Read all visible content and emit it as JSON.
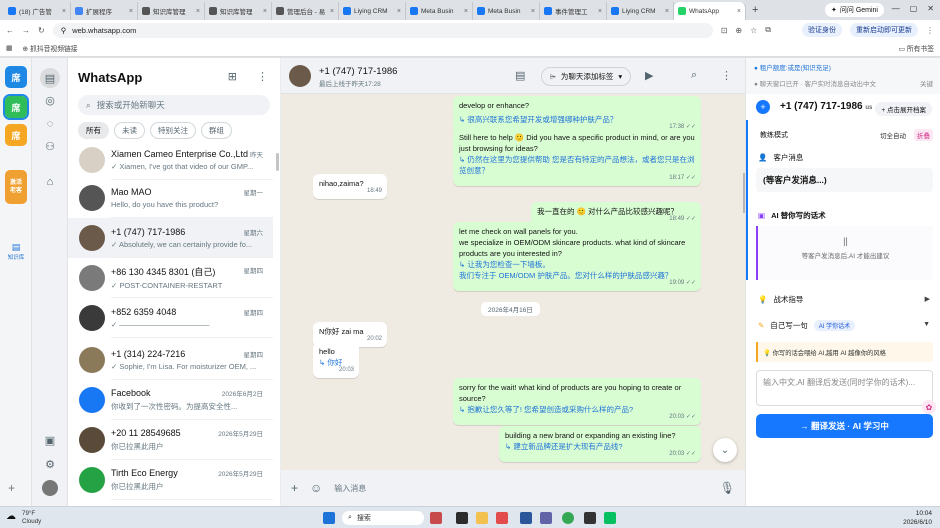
{
  "browser": {
    "tabs": [
      {
        "label": "(18) 广告管",
        "color": "#1877f2"
      },
      {
        "label": "扩展程序",
        "color": "#4285f4"
      },
      {
        "label": "知识库管理",
        "color": "#555555"
      },
      {
        "label": "知识库管理",
        "color": "#555555"
      },
      {
        "label": "管理后台 - 易",
        "color": "#555555"
      },
      {
        "label": "Liying CRM",
        "color": "#1877f2"
      },
      {
        "label": "Meta Busin",
        "color": "#1877f2"
      },
      {
        "label": "Meta Busin",
        "color": "#1877f2"
      },
      {
        "label": "事件管理工",
        "color": "#1877f2"
      },
      {
        "label": "Liying CRM",
        "color": "#1877f2"
      },
      {
        "label": "WhatsApp",
        "color": "#25d366"
      }
    ],
    "new_tab": "+",
    "gemini": "问问 Gemini",
    "url": "web.whatsapp.com",
    "verify": "验证身份",
    "restart": "重新启动即可更新",
    "bookmark": "抓抖音视频链接",
    "all_bookmarks": "所有书签"
  },
  "plugin_strip": {
    "buttons": [
      "席",
      "席",
      "席"
    ],
    "tool_btn": "激活\n老客",
    "label": "知识库"
  },
  "whatsapp": {
    "title": "WhatsApp",
    "search_placeholder": "搜索或开始新聊天",
    "filters": [
      "所有",
      "未读",
      "特别关注",
      "群组"
    ],
    "chats": [
      {
        "name": "Xiamen Cameo Enterprise Co.,Ltd",
        "time": "昨天",
        "snippet": "✓ Xiamen, I've got that video of our GMP...",
        "avatar_color": "#d8d0c4"
      },
      {
        "name": "Mao MAO",
        "time": "星期一",
        "snippet": "Hello, do you have this product?",
        "avatar_color": "#555555"
      },
      {
        "name": "+1 (747) 717-1986",
        "time": "星期六",
        "snippet": "✓ Absolutely, we can certainly provide fo...",
        "avatar_color": "#6b5a4a"
      },
      {
        "name": "+86 130 4345 8301 (自己)",
        "time": "星期四",
        "snippet": "✓ POST-CONTAINER-RESTART",
        "avatar_color": "#7a7a7a"
      },
      {
        "name": "+852 6359 4048",
        "time": "星期四",
        "snippet": "✓ ————————————",
        "avatar_color": "#3a3a3a"
      },
      {
        "name": "+1 (314) 224-7216",
        "time": "星期四",
        "snippet": "✓ Sophie, I'm Lisa. For moisturizer OEM, ...",
        "avatar_color": "#8a7a5a"
      },
      {
        "name": "Facebook",
        "time": "2026年6月2日",
        "snippet": "你收到了一次性密码。为提高安全性...",
        "avatar_color": "#1877f2"
      },
      {
        "name": "+20 11 28549685",
        "time": "2026年5月29日",
        "snippet": "你已拉黑此用户",
        "avatar_color": "#5a4a3a"
      },
      {
        "name": "Tirth Eco Energy",
        "time": "2026年5月29日",
        "snippet": "你已拉黑此用户",
        "avatar_color": "#25a244"
      }
    ]
  },
  "chat": {
    "name": "+1 (747) 717-1986",
    "status": "最后上线于昨天17:28",
    "tag_button": "为聊天添加标签",
    "messages": [
      {
        "dir": "out",
        "text": "develop or enhance?",
        "trans": "",
        "time": ""
      },
      {
        "dir": "out",
        "text": "",
        "trans": "↳ 很高兴联系您希望开发或增强哪种护肤产品？",
        "time": "17:38 ✓✓"
      },
      {
        "dir": "out",
        "text": "Still here to help 🙂 Did you have a specific product in mind, or are you just browsing for ideas?",
        "trans": "↳ 仍然在这里为您提供帮助 您是否有特定的产品想法，或者您只是在浏览创意？",
        "time": "18:17 ✓✓"
      },
      {
        "dir": "in",
        "text": "nihao,zaima?",
        "trans": "",
        "time": "18:49"
      },
      {
        "dir": "out",
        "text": "我一直在的 🙂 对什么产品比较感兴趣呢？",
        "trans": "",
        "time": "18:49 ✓✓"
      },
      {
        "dir": "out",
        "text": "let me check on wall panels for you.\nwe specialize in OEM/ODM skincare products. what kind of skincare products are you interested in?",
        "trans": "↳ 让我为您检查一下墙板。\n我们专注于 OEM/ODM 护肤产品。您对什么样的护肤品感兴趣？",
        "time": "19:09 ✓✓"
      },
      {
        "dir": "date",
        "text": "2026年4月16日"
      },
      {
        "dir": "in",
        "text": "N你好 zai ma",
        "trans": "",
        "time": "20:02"
      },
      {
        "dir": "in",
        "text": "hello",
        "trans": "↳ 你好",
        "time": "20:03"
      },
      {
        "dir": "out",
        "text": "sorry for the wait! what kind of products are you hoping to create or source?",
        "trans": "↳ 抱歉让您久等了! 您希望创造或采购什么样的产品?",
        "time": "20:03 ✓✓"
      },
      {
        "dir": "out",
        "text": "building a new brand or expanding an existing line?",
        "trans": "↳ 建立新品牌还是扩大现有产品线?",
        "time": "20:03 ✓✓"
      }
    ],
    "compose_placeholder": "输入消息"
  },
  "assistant": {
    "notice": "租户额度:或是(知识充足)",
    "connected": "聊天窗口已开 · 客户实时消息自动出中文",
    "connected_extra": "关键",
    "contact": "+1 (747) 717-1986",
    "contact_suffix": "us",
    "profile_btn": "+ 点击展开档案",
    "mode_label": "教练模式",
    "mode_switch": "切全自动",
    "mode_fold": "折叠",
    "customer_msg_title": "客户消息",
    "waiting_customer": "(等客户发消息...)",
    "ai_reply_title": "AI 替你写的话术",
    "pause": "||",
    "ai_waiting": "等客户发消息后,AI 才能出建议",
    "battle_title": "战术指导",
    "self_write_title": "自己写一句",
    "self_write_tag": "AI 学你话术",
    "style_tip": "你写的话会喂给 AI,越用 AI 越像你的风格",
    "input_placeholder": "输入中文,AI 翻译后发送(同时学你的话术)...",
    "send_button": "→ 翻译发送 · AI 学习中"
  },
  "taskbar": {
    "temp": "79°F",
    "weather": "Cloudy",
    "search": "搜索",
    "time": "10:04",
    "date": "2026/6/10"
  }
}
